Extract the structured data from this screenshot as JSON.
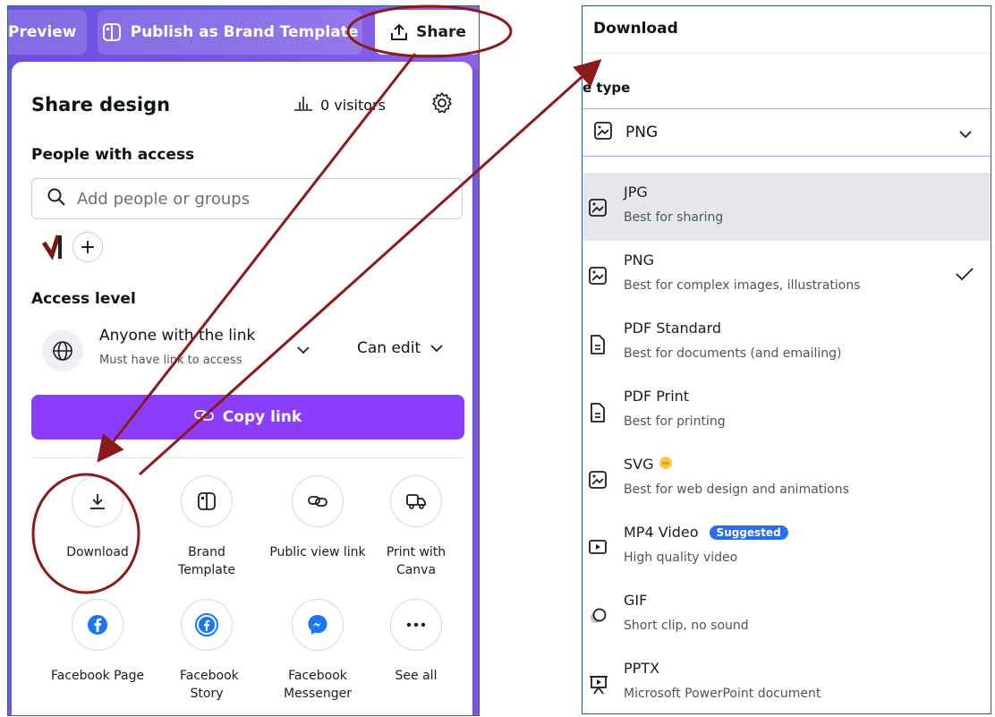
{
  "topbar": {
    "preview_label": "Preview",
    "publish_label": "Publish as Brand Template",
    "share_label": "Share"
  },
  "share": {
    "title": "Share design",
    "visitors": "0 visitors",
    "people_label": "People with access",
    "search_placeholder": "Add people or groups",
    "access_label": "Access level",
    "access_mode": "Anyone with the link",
    "access_hint": "Must have link to access",
    "permission": "Can edit",
    "copy_link": "Copy link",
    "actions": [
      {
        "label": "Download",
        "icon": "download-icon"
      },
      {
        "label": "Brand Template",
        "icon": "brand-template-icon"
      },
      {
        "label": "Public view link",
        "icon": "link-icon"
      },
      {
        "label": "Print with Canva",
        "icon": "truck-icon"
      },
      {
        "label": "Facebook Page",
        "icon": "facebook-icon"
      },
      {
        "label": "Facebook Story",
        "icon": "facebook-story-icon"
      },
      {
        "label": "Facebook Messenger",
        "icon": "messenger-icon"
      },
      {
        "label": "See all",
        "icon": "more-icon"
      }
    ]
  },
  "download": {
    "title": "Download",
    "file_type_label": "e type",
    "selected": "PNG",
    "options": [
      {
        "name": "JPG",
        "desc": "Best for sharing"
      },
      {
        "name": "PNG",
        "desc": "Best for complex images, illustrations"
      },
      {
        "name": "PDF Standard",
        "desc": "Best for documents (and emailing)"
      },
      {
        "name": "PDF Print",
        "desc": "Best for printing"
      },
      {
        "name": "SVG",
        "desc": "Best for web design and animations"
      },
      {
        "name": "MP4 Video",
        "desc": "High quality video",
        "badge": "Suggested"
      },
      {
        "name": "GIF",
        "desc": "Short clip, no sound"
      },
      {
        "name": "PPTX",
        "desc": "Microsoft PowerPoint document"
      }
    ]
  },
  "colors": {
    "accent": "#8b3dff",
    "annotation": "#8b1a1a",
    "suggested_badge": "#2a6df5",
    "panel_border": "#2e5e8c"
  }
}
